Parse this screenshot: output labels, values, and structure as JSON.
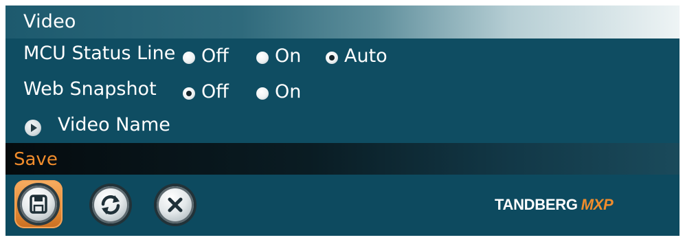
{
  "section": {
    "title": "Video"
  },
  "settings": {
    "mcu_status_line": {
      "label": "MCU Status Line",
      "options": [
        "Off",
        "On",
        "Auto"
      ],
      "selected": "Auto"
    },
    "web_snapshot": {
      "label": "Web Snapshot",
      "options": [
        "Off",
        "On"
      ],
      "selected": "Off"
    },
    "video_name": {
      "label": "Video Name",
      "icon": "arrow-right-icon"
    }
  },
  "save_section": {
    "title": "Save",
    "buttons": [
      {
        "name": "save-button",
        "icon": "floppy-disk-icon",
        "active": true
      },
      {
        "name": "refresh-button",
        "icon": "refresh-icon",
        "active": false
      },
      {
        "name": "cancel-button",
        "icon": "close-icon",
        "active": false
      }
    ]
  },
  "brand": {
    "name": "TANDBERG",
    "model": "MXP"
  },
  "colors": {
    "background": "#0d4a5f",
    "accent": "#f08c2c",
    "text": "#ffffff"
  }
}
